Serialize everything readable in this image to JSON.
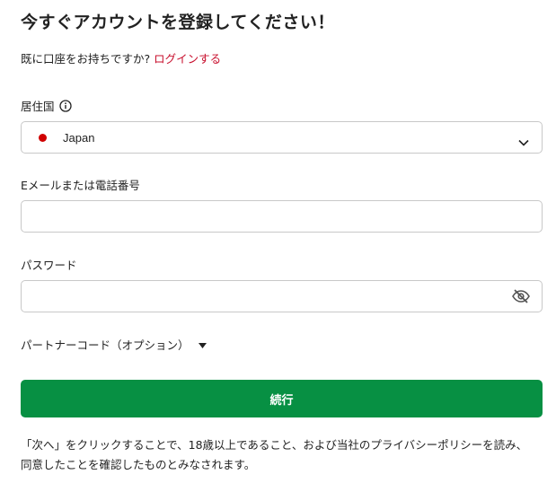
{
  "title": "今すぐアカウントを登録してください！",
  "have_account": {
    "text": "既に口座をお持ちですか? ",
    "login_link": "ログインする"
  },
  "residence": {
    "label": "居住国",
    "selected_country": "Japan",
    "flag_color": "#d00000"
  },
  "contact": {
    "label": "Eメールまたは電話番号",
    "value": ""
  },
  "password": {
    "label": "パスワード",
    "value": ""
  },
  "partner_code": {
    "label": "パートナーコード（オプション）"
  },
  "continue_button": {
    "label": "続行",
    "color": "#079043"
  },
  "terms_text": "「次へ」をクリックすることで、18歳以上であること、および当社のプライバシーポリシーを読み、同意したことを確認したものとみなされます。",
  "icons": {
    "info": "info-icon",
    "chevron": "chevron-down-icon",
    "eye": "eye-off-icon",
    "caret": "caret-down-icon"
  }
}
